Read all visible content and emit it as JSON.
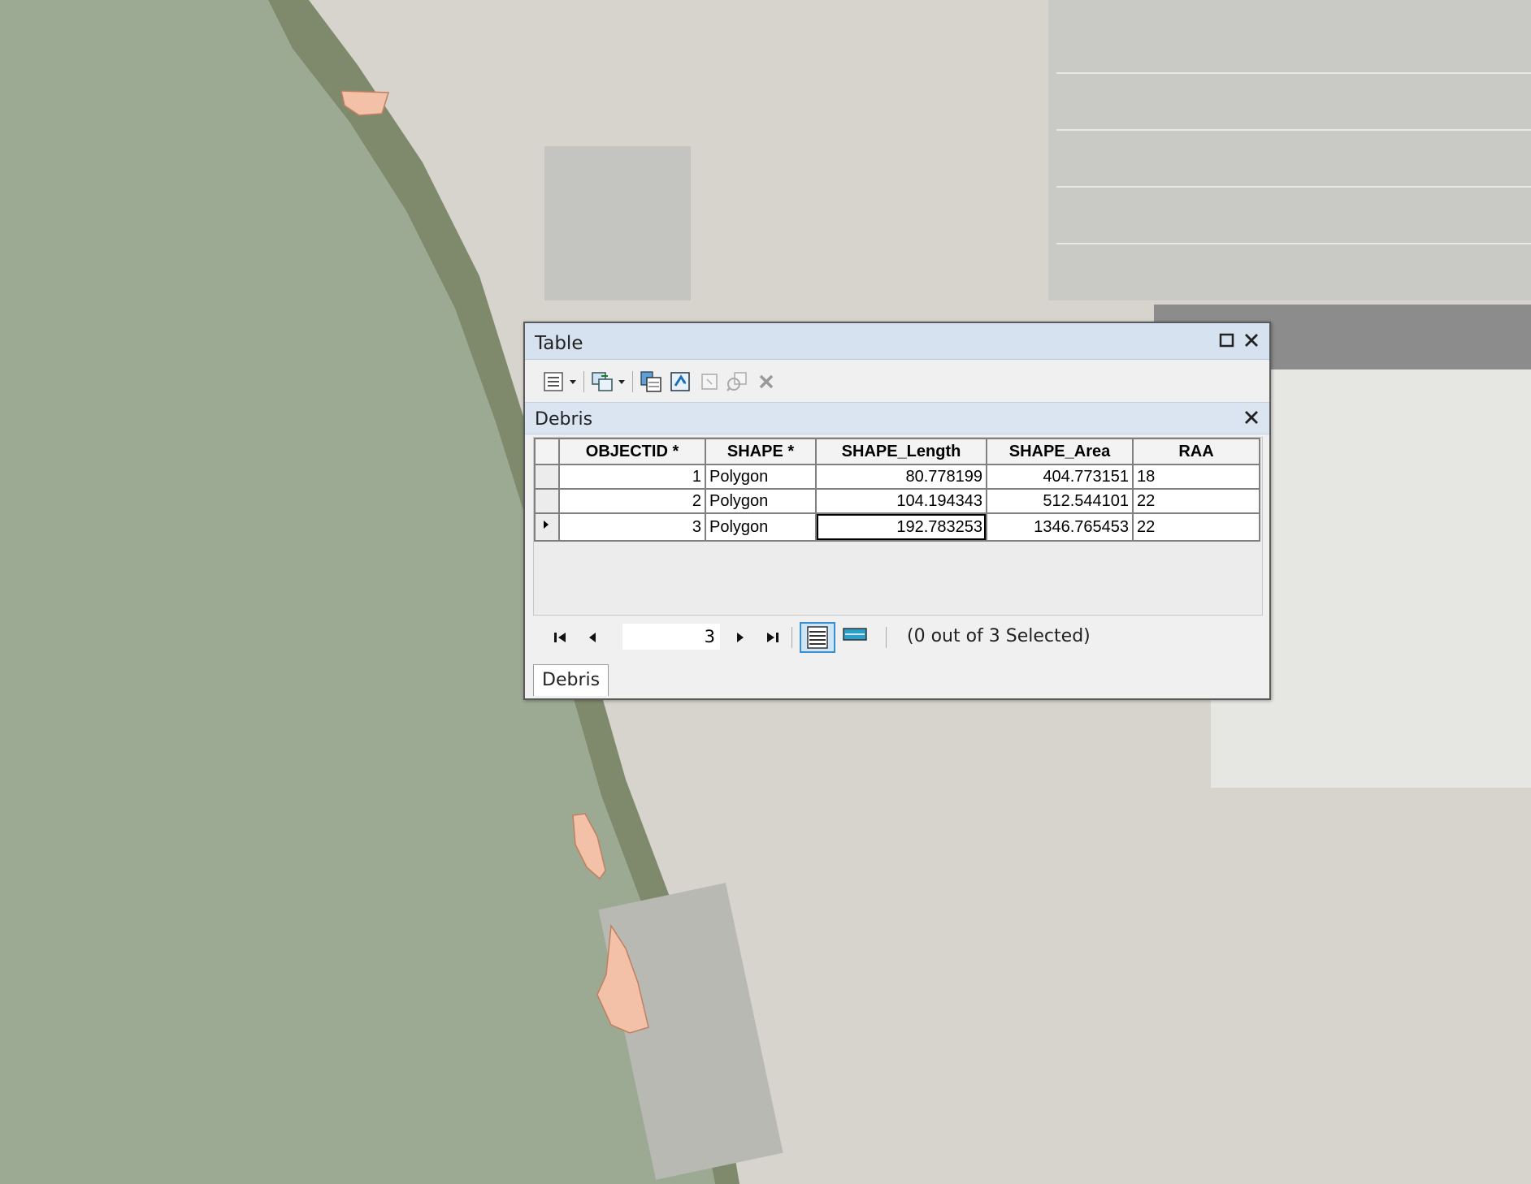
{
  "window": {
    "title": "Table",
    "maximize_icon": "maximize-icon",
    "close_icon": "close-icon"
  },
  "toolbar": {
    "tools": [
      {
        "name": "table-options",
        "icon": "table-options-icon",
        "dropdown": true
      },
      {
        "name": "related-tables",
        "icon": "related-tables-icon",
        "dropdown": true
      },
      {
        "name": "select-by-attributes",
        "icon": "select-by-attributes-icon"
      },
      {
        "name": "switch-selection",
        "icon": "switch-selection-icon"
      },
      {
        "name": "clear-selection",
        "icon": "clear-selection-icon",
        "disabled": true
      },
      {
        "name": "zoom-to-selected",
        "icon": "zoom-to-selected-icon",
        "disabled": true
      },
      {
        "name": "delete-selected",
        "icon": "delete-selected-icon",
        "disabled": true
      }
    ]
  },
  "layer": {
    "title": "Debris",
    "close_icon": "close-icon"
  },
  "table": {
    "columns": [
      "OBJECTID *",
      "SHAPE *",
      "SHAPE_Length",
      "SHAPE_Area",
      "RAA"
    ],
    "rows": [
      {
        "objectid": "1",
        "shape": "Polygon",
        "length": "80.778199",
        "area": "404.773151",
        "raa": "18"
      },
      {
        "objectid": "2",
        "shape": "Polygon",
        "length": "104.194343",
        "area": "512.544101",
        "raa": "22"
      },
      {
        "objectid": "3",
        "shape": "Polygon",
        "length": "192.783253",
        "area": "1346.765453",
        "raa": "22"
      }
    ]
  },
  "navigation": {
    "current_record": "3",
    "selection_status": "(0 out of 3 Selected)"
  },
  "tabs": [
    {
      "label": "Debris",
      "active": true
    }
  ],
  "colors": {
    "water": "#9aa890",
    "debris_polygon": "#f2c1a8",
    "window_title": "#d6e2f0",
    "layer_bar": "#dbe5f1"
  }
}
